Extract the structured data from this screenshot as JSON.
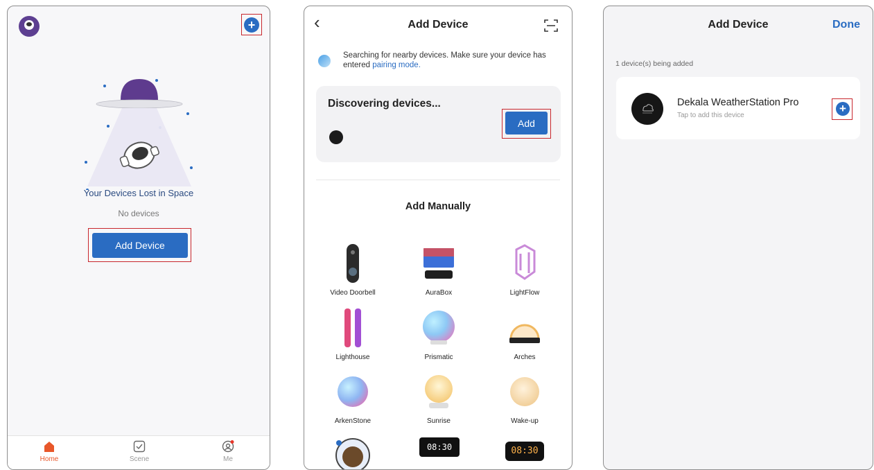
{
  "screen1": {
    "illustration_title": "Your Devices Lost in Space",
    "empty_text": "No devices",
    "add_button": "Add Device",
    "tabs": [
      {
        "label": "Home",
        "icon": "home-icon",
        "active": true
      },
      {
        "label": "Scene",
        "icon": "scene-icon",
        "active": false
      },
      {
        "label": "Me",
        "icon": "profile-icon",
        "active": false
      }
    ]
  },
  "screen2": {
    "title": "Add Device",
    "back_glyph": "‹",
    "search_notice": "Searching for nearby devices. Make sure your device has entered",
    "pairing_link": "pairing mode.",
    "discover_title": "Discovering devices...",
    "add_button": "Add",
    "manual_title": "Add Manually",
    "devices": [
      {
        "label": "Video Doorbell",
        "icon": "doorbell-icon"
      },
      {
        "label": "AuraBox",
        "icon": "aurabox-icon"
      },
      {
        "label": "LightFlow",
        "icon": "lightflow-icon"
      },
      {
        "label": "Lighthouse",
        "icon": "lighthouse-icon"
      },
      {
        "label": "Prismatic",
        "icon": "prismatic-icon"
      },
      {
        "label": "Arches",
        "icon": "arches-icon"
      },
      {
        "label": "ArkenStone",
        "icon": "arkenstone-icon"
      },
      {
        "label": "Sunrise",
        "icon": "sunrise-icon"
      },
      {
        "label": "Wake-up",
        "icon": "wakeup-icon"
      }
    ],
    "clock_text": "08:30"
  },
  "screen3": {
    "title": "Add Device",
    "done": "Done",
    "count_text": "1 device(s) being added",
    "device_name": "Dekala WeatherStation Pro",
    "device_hint": "Tap to add this device"
  },
  "colors": {
    "accent": "#2a6cc2",
    "highlight": "#c8262c",
    "active_tab": "#e8572a"
  }
}
